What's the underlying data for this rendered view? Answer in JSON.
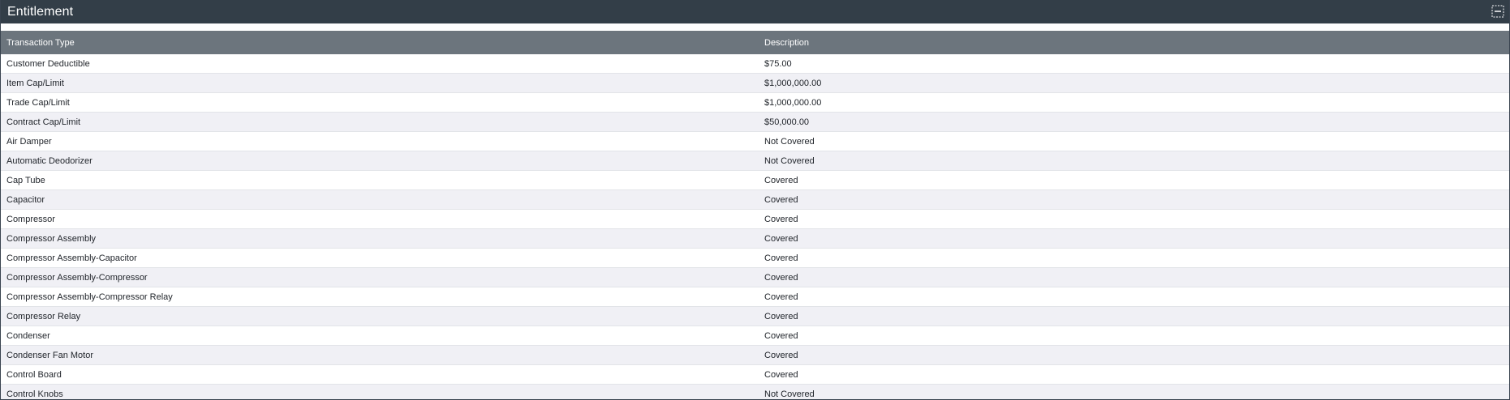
{
  "panel": {
    "title": "Entitlement",
    "collapse_icon": "collapse-icon"
  },
  "table": {
    "columns": [
      "Transaction Type",
      "Description"
    ],
    "rows": [
      [
        "Customer Deductible",
        "$75.00"
      ],
      [
        "Item Cap/Limit",
        "$1,000,000.00"
      ],
      [
        "Trade Cap/Limit",
        "$1,000,000.00"
      ],
      [
        "Contract Cap/Limit",
        "$50,000.00"
      ],
      [
        "Air Damper",
        "Not Covered"
      ],
      [
        "Automatic Deodorizer",
        "Not Covered"
      ],
      [
        "Cap Tube",
        "Covered"
      ],
      [
        "Capacitor",
        "Covered"
      ],
      [
        "Compressor",
        "Covered"
      ],
      [
        "Compressor Assembly",
        "Covered"
      ],
      [
        "Compressor Assembly-Capacitor",
        "Covered"
      ],
      [
        "Compressor Assembly-Compressor",
        "Covered"
      ],
      [
        "Compressor Assembly-Compressor Relay",
        "Covered"
      ],
      [
        "Compressor Relay",
        "Covered"
      ],
      [
        "Condenser",
        "Covered"
      ],
      [
        "Condenser Fan Motor",
        "Covered"
      ],
      [
        "Control Board",
        "Covered"
      ],
      [
        "Control Knobs",
        "Not Covered"
      ]
    ]
  },
  "colors": {
    "header_bg": "#333e48",
    "column_header_bg": "#6c757d",
    "row_alt_bg": "#f0f0f5"
  }
}
